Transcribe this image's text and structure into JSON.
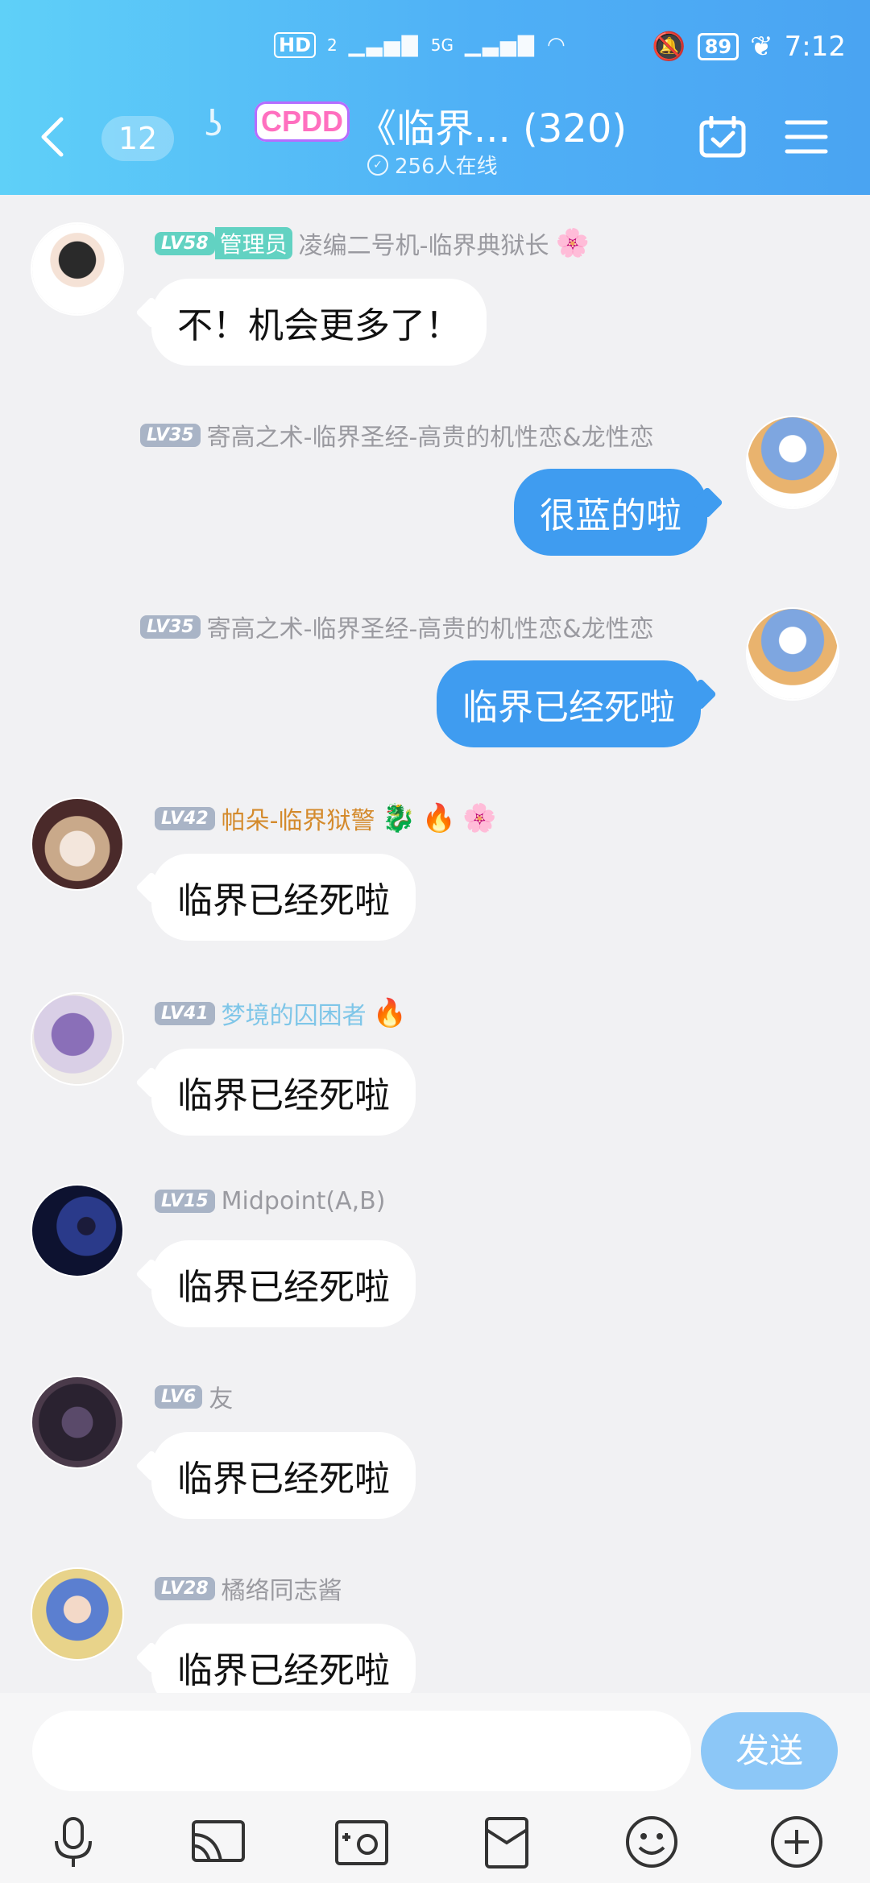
{
  "status_bar": {
    "hd": "HD",
    "sim": "2",
    "network": "5G",
    "battery": "89",
    "time": "7:12"
  },
  "header": {
    "unread_count": "12",
    "logo_text": "CPDD",
    "title": "《临界...  (320)",
    "online_text": "256人在线"
  },
  "messages": [
    {
      "side": "left",
      "level": "LV58",
      "role": "管理员",
      "name": "凌编二号机-临界典狱长",
      "text": "不！机会更多了！"
    },
    {
      "side": "right",
      "level": "LV35",
      "name": "寄高之术-临界圣经-高贵的机性恋&龙性恋",
      "text": "很蓝的啦"
    },
    {
      "side": "right",
      "level": "LV35",
      "name": "寄高之术-临界圣经-高贵的机性恋&龙性恋",
      "text": "临界已经死啦"
    },
    {
      "side": "left",
      "level": "LV42",
      "name": "帕朵-临界狱警",
      "text": "临界已经死啦"
    },
    {
      "side": "left",
      "level": "LV41",
      "name": "梦境的囚困者",
      "text": "临界已经死啦"
    },
    {
      "side": "left",
      "level": "LV15",
      "name": "Midpoint(A,B)",
      "text": "临界已经死啦"
    },
    {
      "side": "left",
      "level": "LV6",
      "name": "友",
      "text": "临界已经死啦"
    },
    {
      "side": "left",
      "level": "LV28",
      "name": "橘络同志酱",
      "text": "临界已经死啦"
    }
  ],
  "input": {
    "placeholder": "",
    "send_label": "发送"
  },
  "colors": {
    "header_start": "#5fd0f8",
    "header_end": "#4aa4f2",
    "outgoing_bubble": "#3f9cf0",
    "send_button": "#8cc7f7"
  }
}
